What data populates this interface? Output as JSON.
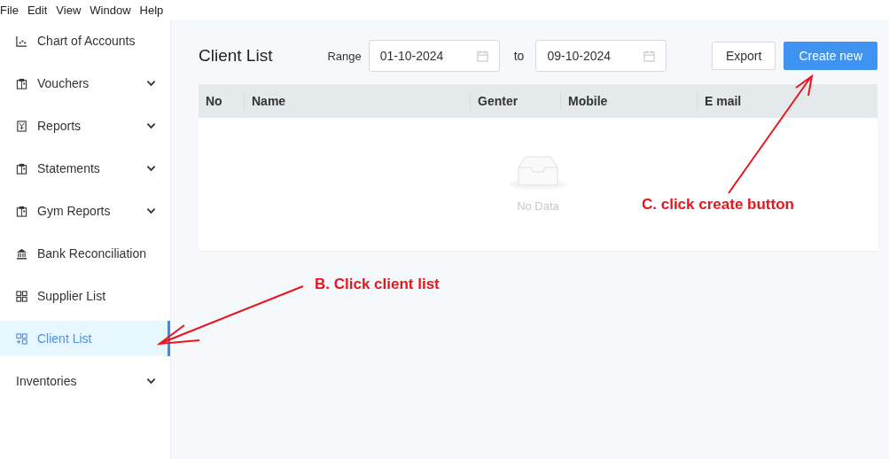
{
  "menu_bar": [
    "File",
    "Edit",
    "View",
    "Window",
    "Help"
  ],
  "sidebar": {
    "items": [
      {
        "label": "Chart of Accounts",
        "expandable": false,
        "selected": false
      },
      {
        "label": "Vouchers",
        "expandable": true,
        "selected": false
      },
      {
        "label": "Reports",
        "expandable": true,
        "selected": false
      },
      {
        "label": "Statements",
        "expandable": true,
        "selected": false
      },
      {
        "label": "Gym Reports",
        "expandable": true,
        "selected": false
      },
      {
        "label": "Bank Reconciliation",
        "expandable": false,
        "selected": false
      },
      {
        "label": "Supplier List",
        "expandable": false,
        "selected": false
      },
      {
        "label": "Client List",
        "expandable": false,
        "selected": true
      },
      {
        "label": "Inventories",
        "expandable": true,
        "selected": false
      }
    ]
  },
  "page": {
    "title": "Client List",
    "range_label": "Range",
    "from_date": "01-10-2024",
    "to_label": "to",
    "to_date": "09-10-2024",
    "buttons": [
      {
        "label": "Export",
        "kind": "default"
      },
      {
        "label": "Create new",
        "kind": "primary"
      }
    ]
  },
  "table": {
    "columns": [
      "No",
      "Name",
      "Genter",
      "Mobile",
      "E mail"
    ],
    "empty_text": "No Data"
  },
  "annotations": [
    {
      "label": "C. click create button"
    },
    {
      "label": "B. Click client list"
    }
  ]
}
